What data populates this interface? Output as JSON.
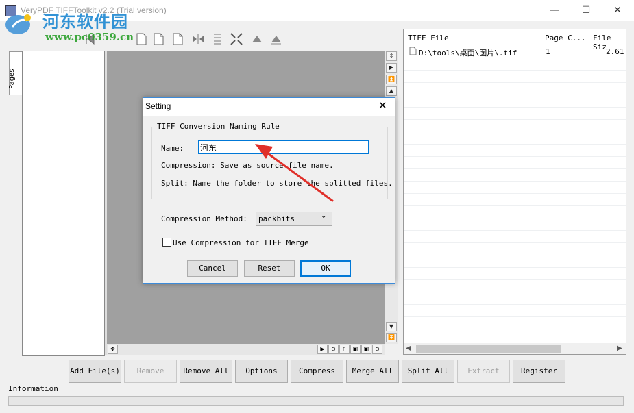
{
  "window": {
    "title": "VeryPDF TIFFToolkit v2.2 (Trial version)",
    "minimize": "—",
    "maximize": "☐",
    "close": "✕"
  },
  "watermark": {
    "line1": "河东软件园",
    "line2": "www.pc0359.cn"
  },
  "side_tab": {
    "label": "Pages"
  },
  "file_list": {
    "columns": [
      "TIFF File",
      "Page C...",
      "File Siz"
    ],
    "rows": [
      {
        "file": "D:\\tools\\桌面\\图片\\.tif",
        "pages": "1",
        "size": "2.61"
      }
    ]
  },
  "buttons": {
    "add": "Add File(s)",
    "remove": "Remove",
    "remove_all": "Remove All",
    "options": "Options",
    "compress": "Compress",
    "merge_all": "Merge All",
    "split_all": "Split All",
    "extract": "Extract",
    "register": "Register"
  },
  "info": {
    "label": "Information"
  },
  "dialog": {
    "title": "Setting",
    "close": "✕",
    "group_title": "TIFF Conversion Naming Rule",
    "name_label": "Name:",
    "name_value": "河东",
    "compression_info": "Compression: Save as source file name.",
    "split_info": "Split: Name the folder to store the splitted files.",
    "method_label": "Compression Method:",
    "method_value": "packbits",
    "checkbox_label": "Use Compression for TIFF Merge",
    "checkbox_checked": false,
    "cancel": "Cancel",
    "reset": "Reset",
    "ok": "OK"
  },
  "colors": {
    "accent": "#0078d7",
    "annotation_arrow": "#e0302a",
    "watermark_blue": "#1e88d2",
    "watermark_green": "#2aa02a"
  }
}
